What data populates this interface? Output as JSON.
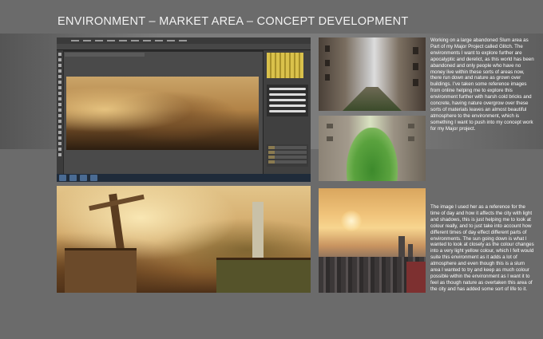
{
  "page": {
    "title": "ENVIRONMENT – MARKET AREA – CONCEPT DEVELOPMENT"
  },
  "text_blocks": {
    "top": "Working on a large abandoned Slum area as Part of my Major Project called Glitch. The environments I want to explore further are apocalyptic and derelict, as this world has been abandoned and only people who have no money live within these sorts of areas now, there run down and nature as grown over buildings. I've taken some reference images from online helping me to explore this environment further with harsh cold bricks and concrete, having nature overgrow over these sorts of materials leaves an almost beautiful atmosphere to the environment, which is something I want to push into my concept work for my Major project.",
    "bottom": "The image I used her as a reference for the time of day and how it affects the city with light and shadows, this is just helping me to look at colour really, and to just take into account how different times of day effect different parts of environments. The sun going down is what I wanted to look at closely as the colour changes into a very light yellow colour, which I felt would suite this environment as it adds a lot of atmosphere and even though this is a slum area I wanted to try and keep as much colour possible within the environment as I want it to feel as though nature as overtaken this area of the city and has added some sort of life to it."
  },
  "colors": {
    "background": "#6b6b6b",
    "band": "#7c7c7c",
    "text": "#ffffff"
  }
}
